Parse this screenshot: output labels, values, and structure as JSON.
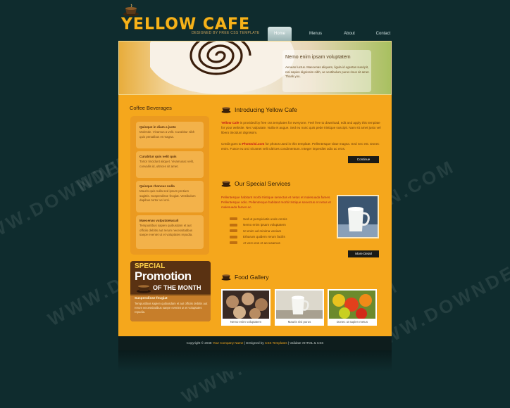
{
  "header": {
    "logo": "YELLOW CAFE",
    "tagline": "DESIGNED BY FREE CSS TEMPLATE"
  },
  "nav": [
    "Home",
    "Menus",
    "About",
    "Contact"
  ],
  "banner": {
    "title": "Nemo enim ipsam voluptatem",
    "text": "Aenean luctus. Maecenas aliquam, ligula id egestas suscipit, nisi sapien dignissim nibh, ac vestibulum purus risus sit amet. Thank you."
  },
  "sidebar": {
    "title": "Coffee Beverages",
    "items": [
      {
        "title": "Quisque in diam a justo",
        "text": "Molestie. Vivamus a velit. Curabitur nibh quis penatibus et magna."
      },
      {
        "title": "Curabitur quis velit quis",
        "text": "Tortor tincidunt aliquet. Vivamusac velit, convallis id, ultrices sit amet."
      },
      {
        "title": "Quisque rhoncus nulla",
        "text": "Mauris quis nulla sed ipsum pretium sagittis. Suspendisse feugiat. Vestibulum dapibus tortor vel orci."
      },
      {
        "title": "Maecenas vulputateiaculi",
        "text": "Tempustibus sapien quibusdam et aut officiis debitis aut rerum necessitatibus saepe eveniet ut et voluptates repudia."
      }
    ],
    "promo": {
      "special": "SPECIAL",
      "promotion": "Promotion",
      "month": "OF THE MONTH",
      "title": "Suspendisse feugiat",
      "text": "Tempustibus sapien quibusdam et aut officiis debitis aut rerum necessitatibus saepe eveniet ut et voluptates repudia."
    }
  },
  "intro": {
    "title": "Introducing Yellow Cafe",
    "para1_lead": "Yellow Cafe",
    "para1": " is provided by free css templates for everyone. Feel free to download, edit and apply this template for your website. Nec vulputate. Nulla et augue. Sed eu nunc quis pede tristique suscipit. Nam sit amet justo vel libero tincidunt dignissim.",
    "para2_pre": "Credit goes to ",
    "para2_link": "Photovisi.com",
    "para2": " for photos used in this template. Pellentesque vitae magna. Sed nec est. Donec enim. Fusce eu orci sit amet velit ultrices condimentum. Integer imperdiet odio ac eros.",
    "button": "Continue"
  },
  "services": {
    "title": "Our Special Services",
    "para": "Pellentesque habitant morbi tristique senectus et netus et malesuada fames. Pellentesque odio. Pellentesque habitant morbi tristique senectus et netus et malesuada fames ac.",
    "list": [
      "Sed ut perspiciatis unde omnis",
      "Nemo enim ipsam voluptatem",
      "Ut enim ad minima veniam",
      "Etharum quidem rerum facilis",
      "At vero eos et accusamus"
    ],
    "button": "More Detail"
  },
  "gallery": {
    "title": "Food Gallery",
    "items": [
      "Nemo enim voluptatem",
      "Mauris nisi purus",
      "Donec ut sapien metus"
    ]
  },
  "footer": {
    "pre": "Copyright © 2048 ",
    "company": "Your Company Name",
    "mid": " | Designed by ",
    "designer": "CSS Templates",
    "post": " | Validate XHTML & CSS"
  },
  "watermark": "WWW.DOWNDEN.COM",
  "colors": {
    "background": "#0f2c2e",
    "content": "#f5a71c",
    "logo": "#f6b21a",
    "link": "#c0121b"
  }
}
